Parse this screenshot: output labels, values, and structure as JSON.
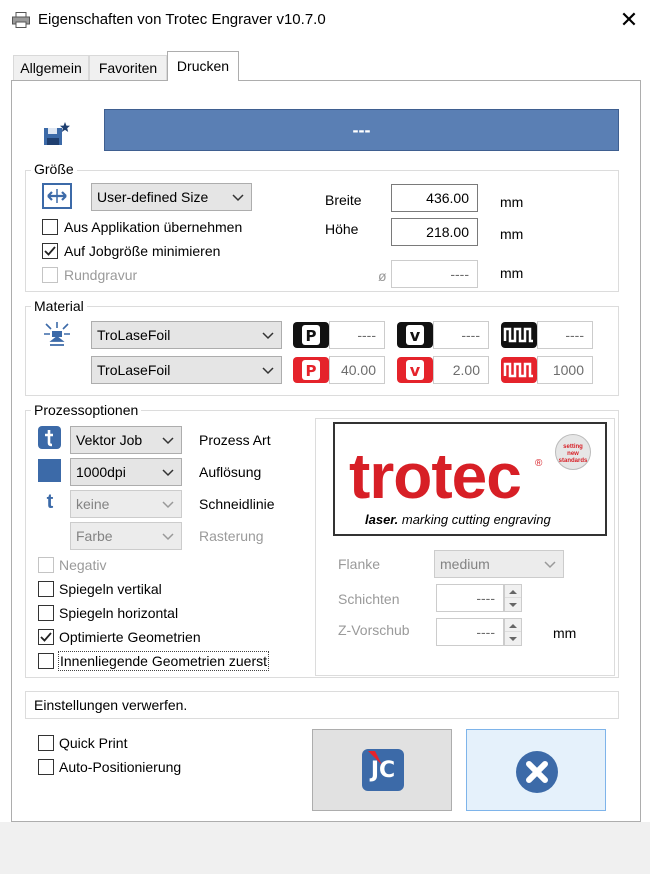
{
  "window": {
    "title": "Eigenschaften von Trotec Engraver v10.7.0",
    "close_symbol": "✕"
  },
  "tabs": [
    {
      "label": "Allgemein",
      "active": false
    },
    {
      "label": "Favoriten",
      "active": false
    },
    {
      "label": "Drucken",
      "active": true
    }
  ],
  "job_banner": {
    "text": "---",
    "color": "#5a7fb4"
  },
  "groesse": {
    "label": "Größe",
    "size_select": "User-defined Size",
    "aus_applikation": {
      "label": "Aus Applikation übernehmen",
      "checked": false
    },
    "auf_jobgroesse": {
      "label": "Auf Jobgröße minimieren",
      "checked": true
    },
    "rundgravur": {
      "label": "Rundgravur",
      "checked": false,
      "enabled": false
    },
    "breite": {
      "label": "Breite",
      "value": "436.00",
      "unit": "mm"
    },
    "hoehe": {
      "label": "Höhe",
      "value": "218.00",
      "unit": "mm"
    },
    "durchmesser": {
      "symbol": "ø",
      "value": "----",
      "unit": "mm"
    }
  },
  "material": {
    "label": "Material",
    "row1": {
      "select": "TroLaseFoil",
      "power": "----",
      "velocity": "----",
      "frequency": "----"
    },
    "row2": {
      "select": "TroLaseFoil",
      "power": "40.00",
      "velocity": "2.00",
      "frequency": "1000"
    },
    "badge_p": "P",
    "badge_v": "v",
    "badge_black": "#111111",
    "badge_red": "#e5232b"
  },
  "prozess": {
    "label": "Prozessoptionen",
    "prozess_art": {
      "value": "Vektor Job",
      "label": "Prozess Art"
    },
    "aufloesung": {
      "value": "1000dpi",
      "label": "Auflösung"
    },
    "schneidlinie": {
      "value": "keine",
      "label": "Schneidlinie",
      "icon_text": "t"
    },
    "rasterung": {
      "value": "Farbe",
      "label": "Rasterung"
    },
    "negativ": {
      "label": "Negativ",
      "checked": false,
      "enabled": false
    },
    "spiegeln_vertikal": {
      "label": "Spiegeln vertikal",
      "checked": false
    },
    "spiegeln_horizontal": {
      "label": "Spiegeln horizontal",
      "checked": false
    },
    "optimierte_geometrien": {
      "label": "Optimierte Geometrien",
      "checked": true
    },
    "innenliegende": {
      "label": "Innenliegende Geometrien zuerst",
      "checked": false
    },
    "flanke": {
      "label": "Flanke",
      "value": "medium"
    },
    "schichten": {
      "label": "Schichten",
      "value": "----"
    },
    "z_vorschub": {
      "label": "Z-Vorschub",
      "value": "----",
      "unit": "mm"
    }
  },
  "logo": {
    "brand": "trotec",
    "registered": "®",
    "tagline_bold": "laser.",
    "tagline_rest": " marking cutting engraving",
    "seal": [
      "setting",
      "new",
      "standards"
    ],
    "brand_color": "#d71f26"
  },
  "status_text": "Einstellungen verwerfen.",
  "quick_print": {
    "label": "Quick Print",
    "checked": false
  },
  "auto_positionierung": {
    "label": "Auto-Positionierung",
    "checked": false
  },
  "jc_button": {
    "text": "JC"
  },
  "colors": {
    "accent_blue": "#3c6aa8",
    "banner": "#5a7fb4",
    "logo_red": "#d71f26"
  }
}
